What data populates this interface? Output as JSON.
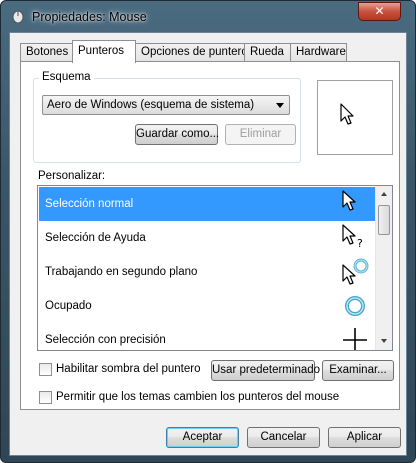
{
  "window": {
    "title": "Propiedades: Mouse",
    "close_glyph": "✕"
  },
  "tabs": [
    {
      "label": "Botones"
    },
    {
      "label": "Punteros",
      "active": true
    },
    {
      "label": "Opciones de puntero"
    },
    {
      "label": "Rueda"
    },
    {
      "label": "Hardware"
    }
  ],
  "scheme": {
    "group_label": "Esquema",
    "selected": "Aero de Windows (esquema de sistema)",
    "save_as_label": "Guardar como...",
    "delete_label": "Eliminar"
  },
  "customize": {
    "label": "Personalizar:",
    "items": [
      {
        "label": "Selección normal",
        "icon": "arrow-cursor-icon",
        "selected": true
      },
      {
        "label": "Selección de Ayuda",
        "icon": "help-cursor-icon"
      },
      {
        "label": "Trabajando en segundo plano",
        "icon": "working-cursor-icon"
      },
      {
        "label": "Ocupado",
        "icon": "busy-cursor-icon"
      },
      {
        "label": "Selección con precisión",
        "icon": "crosshair-cursor-icon"
      }
    ]
  },
  "options": {
    "shadow_label": "Habilitar sombra del puntero",
    "shadow_checked": false,
    "use_default_label": "Usar predeterminado",
    "browse_label": "Examinar...",
    "themes_label": "Permitir que los temas cambien los punteros del mouse",
    "themes_checked": false
  },
  "footer": {
    "ok_label": "Aceptar",
    "cancel_label": "Cancelar",
    "apply_label": "Aplicar"
  },
  "colors": {
    "selection": "#3399ff",
    "title_bar": "#3b5568",
    "close_button": "#c75240"
  }
}
